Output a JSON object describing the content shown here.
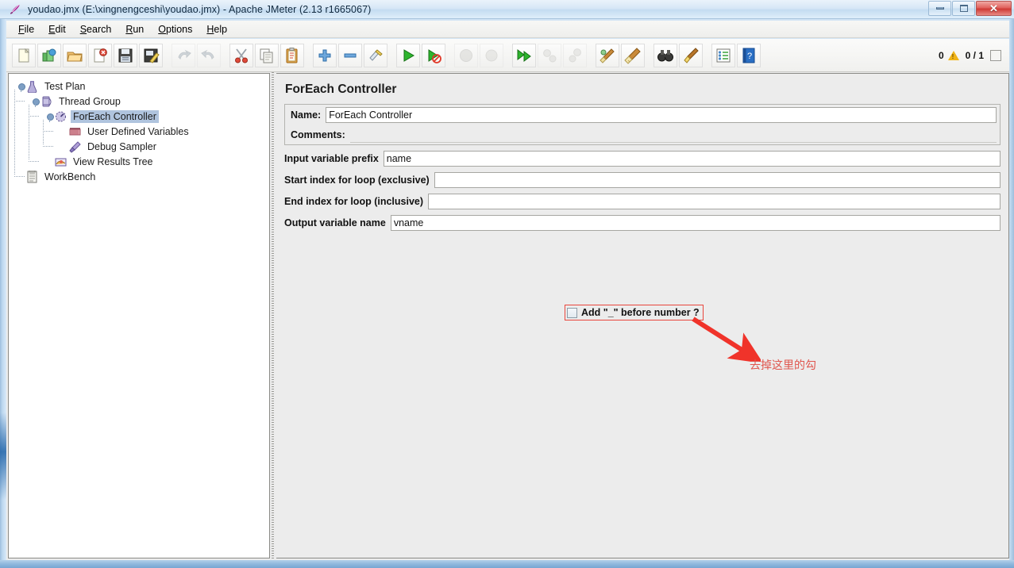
{
  "window": {
    "title": "youdao.jmx (E:\\xingnengceshi\\youdao.jmx) - Apache JMeter (2.13 r1665067)",
    "app_icon": "quill-icon",
    "buttons": {
      "minimize": "minimize-icon",
      "maximize": "maximize-icon",
      "close": "✕"
    }
  },
  "menubar": {
    "items": [
      {
        "label": "File",
        "mnemonic": "F"
      },
      {
        "label": "Edit",
        "mnemonic": "E"
      },
      {
        "label": "Search",
        "mnemonic": "S"
      },
      {
        "label": "Run",
        "mnemonic": "R"
      },
      {
        "label": "Options",
        "mnemonic": "O"
      },
      {
        "label": "Help",
        "mnemonic": "H"
      }
    ]
  },
  "toolbar": {
    "buttons": [
      {
        "name": "new-button",
        "icon": "new-document-icon",
        "enabled": true
      },
      {
        "name": "templates-button",
        "icon": "templates-icon",
        "enabled": true
      },
      {
        "name": "open-button",
        "icon": "open-folder-icon",
        "enabled": true
      },
      {
        "name": "close-button",
        "icon": "close-document-icon",
        "enabled": true
      },
      {
        "name": "save-button",
        "icon": "save-floppy-icon",
        "enabled": true
      },
      {
        "name": "save-as-button",
        "icon": "save-as-icon",
        "enabled": true
      },
      {
        "name": "undo-button",
        "icon": "undo-arrow-icon",
        "enabled": false
      },
      {
        "name": "redo-button",
        "icon": "redo-arrow-icon",
        "enabled": false
      },
      {
        "name": "cut-button",
        "icon": "scissors-icon",
        "enabled": true
      },
      {
        "name": "copy-button",
        "icon": "copy-pages-icon",
        "enabled": true
      },
      {
        "name": "paste-button",
        "icon": "clipboard-icon",
        "enabled": true
      },
      {
        "name": "expand-all-button",
        "icon": "plus-icon",
        "enabled": true
      },
      {
        "name": "collapse-all-button",
        "icon": "minus-icon",
        "enabled": true
      },
      {
        "name": "toggle-button",
        "icon": "toggle-pencil-icon",
        "enabled": true
      },
      {
        "name": "start-button",
        "icon": "green-play-icon",
        "enabled": true
      },
      {
        "name": "start-no-pauses-button",
        "icon": "play-no-pause-icon",
        "enabled": true
      },
      {
        "name": "stop-button",
        "icon": "stop-gray-icon",
        "enabled": false
      },
      {
        "name": "shutdown-button",
        "icon": "shutdown-gray-icon",
        "enabled": false
      },
      {
        "name": "start-remote-button",
        "icon": "remote-start-icon",
        "enabled": true
      },
      {
        "name": "stop-remote-button",
        "icon": "remote-stop-icon",
        "enabled": false
      },
      {
        "name": "shutdown-remote-button",
        "icon": "remote-shutdown-icon",
        "enabled": false
      },
      {
        "name": "clear-button",
        "icon": "broom-single-icon",
        "enabled": true
      },
      {
        "name": "clear-all-button",
        "icon": "broom-all-icon",
        "enabled": true
      },
      {
        "name": "search-button",
        "icon": "binoculars-icon",
        "enabled": true
      },
      {
        "name": "reset-search-button",
        "icon": "brush-icon",
        "enabled": true
      },
      {
        "name": "function-helper-button",
        "icon": "list-icon",
        "enabled": true
      },
      {
        "name": "help-button",
        "icon": "help-book-icon",
        "enabled": true
      }
    ],
    "status": {
      "warning_count": "0",
      "warning_icon": "warning-triangle-icon",
      "thread_counter": "0 / 1"
    }
  },
  "tree": {
    "nodes": [
      {
        "label": "Test Plan",
        "icon": "test-plan-icon",
        "depth": 0,
        "selected": false,
        "expanded": true
      },
      {
        "label": "Thread Group",
        "icon": "thread-group-icon",
        "depth": 1,
        "selected": false,
        "expanded": true
      },
      {
        "label": "ForEach Controller",
        "icon": "controller-icon",
        "depth": 2,
        "selected": true,
        "expanded": true
      },
      {
        "label": "User Defined Variables",
        "icon": "config-icon",
        "depth": 3,
        "selected": false,
        "expanded": false
      },
      {
        "label": "Debug Sampler",
        "icon": "sampler-icon",
        "depth": 3,
        "selected": false,
        "expanded": false
      },
      {
        "label": "View Results Tree",
        "icon": "listener-icon",
        "depth": 2,
        "selected": false,
        "expanded": false
      },
      {
        "label": "WorkBench",
        "icon": "workbench-icon",
        "depth": 0,
        "selected": false,
        "expanded": false
      }
    ]
  },
  "panel": {
    "title": "ForEach Controller",
    "fields": {
      "name_label": "Name:",
      "name_value": "ForEach Controller",
      "comments_label": "Comments:",
      "comments_value": "",
      "input_prefix_label": "Input variable prefix",
      "input_prefix_value": "name",
      "start_index_label": "Start index for loop (exclusive)",
      "start_index_value": "",
      "end_index_label": "End index for loop (inclusive)",
      "end_index_value": "",
      "output_var_label": "Output variable name",
      "output_var_value": "vname",
      "underscore_checkbox_label": "Add \"_\" before number ?",
      "underscore_checkbox_checked": false
    }
  },
  "annotation": {
    "text": "去掉这里的勾",
    "color": "#e0564e",
    "box_color": "#e8453c",
    "arrow_icon": "red-arrow-icon"
  }
}
